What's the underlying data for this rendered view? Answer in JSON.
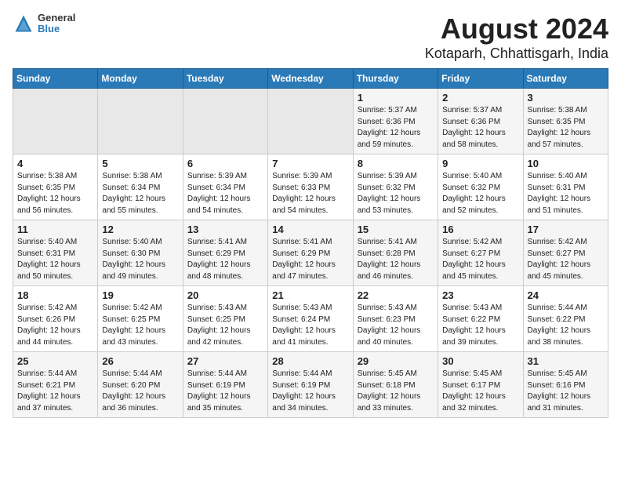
{
  "header": {
    "logo_line1": "General",
    "logo_line2": "Blue",
    "title": "August 2024",
    "subtitle": "Kotaparh, Chhattisgarh, India"
  },
  "weekdays": [
    "Sunday",
    "Monday",
    "Tuesday",
    "Wednesday",
    "Thursday",
    "Friday",
    "Saturday"
  ],
  "weeks": [
    [
      {
        "day": "",
        "info": ""
      },
      {
        "day": "",
        "info": ""
      },
      {
        "day": "",
        "info": ""
      },
      {
        "day": "",
        "info": ""
      },
      {
        "day": "1",
        "info": "Sunrise: 5:37 AM\nSunset: 6:36 PM\nDaylight: 12 hours\nand 59 minutes."
      },
      {
        "day": "2",
        "info": "Sunrise: 5:37 AM\nSunset: 6:36 PM\nDaylight: 12 hours\nand 58 minutes."
      },
      {
        "day": "3",
        "info": "Sunrise: 5:38 AM\nSunset: 6:35 PM\nDaylight: 12 hours\nand 57 minutes."
      }
    ],
    [
      {
        "day": "4",
        "info": "Sunrise: 5:38 AM\nSunset: 6:35 PM\nDaylight: 12 hours\nand 56 minutes."
      },
      {
        "day": "5",
        "info": "Sunrise: 5:38 AM\nSunset: 6:34 PM\nDaylight: 12 hours\nand 55 minutes."
      },
      {
        "day": "6",
        "info": "Sunrise: 5:39 AM\nSunset: 6:34 PM\nDaylight: 12 hours\nand 54 minutes."
      },
      {
        "day": "7",
        "info": "Sunrise: 5:39 AM\nSunset: 6:33 PM\nDaylight: 12 hours\nand 54 minutes."
      },
      {
        "day": "8",
        "info": "Sunrise: 5:39 AM\nSunset: 6:32 PM\nDaylight: 12 hours\nand 53 minutes."
      },
      {
        "day": "9",
        "info": "Sunrise: 5:40 AM\nSunset: 6:32 PM\nDaylight: 12 hours\nand 52 minutes."
      },
      {
        "day": "10",
        "info": "Sunrise: 5:40 AM\nSunset: 6:31 PM\nDaylight: 12 hours\nand 51 minutes."
      }
    ],
    [
      {
        "day": "11",
        "info": "Sunrise: 5:40 AM\nSunset: 6:31 PM\nDaylight: 12 hours\nand 50 minutes."
      },
      {
        "day": "12",
        "info": "Sunrise: 5:40 AM\nSunset: 6:30 PM\nDaylight: 12 hours\nand 49 minutes."
      },
      {
        "day": "13",
        "info": "Sunrise: 5:41 AM\nSunset: 6:29 PM\nDaylight: 12 hours\nand 48 minutes."
      },
      {
        "day": "14",
        "info": "Sunrise: 5:41 AM\nSunset: 6:29 PM\nDaylight: 12 hours\nand 47 minutes."
      },
      {
        "day": "15",
        "info": "Sunrise: 5:41 AM\nSunset: 6:28 PM\nDaylight: 12 hours\nand 46 minutes."
      },
      {
        "day": "16",
        "info": "Sunrise: 5:42 AM\nSunset: 6:27 PM\nDaylight: 12 hours\nand 45 minutes."
      },
      {
        "day": "17",
        "info": "Sunrise: 5:42 AM\nSunset: 6:27 PM\nDaylight: 12 hours\nand 45 minutes."
      }
    ],
    [
      {
        "day": "18",
        "info": "Sunrise: 5:42 AM\nSunset: 6:26 PM\nDaylight: 12 hours\nand 44 minutes."
      },
      {
        "day": "19",
        "info": "Sunrise: 5:42 AM\nSunset: 6:25 PM\nDaylight: 12 hours\nand 43 minutes."
      },
      {
        "day": "20",
        "info": "Sunrise: 5:43 AM\nSunset: 6:25 PM\nDaylight: 12 hours\nand 42 minutes."
      },
      {
        "day": "21",
        "info": "Sunrise: 5:43 AM\nSunset: 6:24 PM\nDaylight: 12 hours\nand 41 minutes."
      },
      {
        "day": "22",
        "info": "Sunrise: 5:43 AM\nSunset: 6:23 PM\nDaylight: 12 hours\nand 40 minutes."
      },
      {
        "day": "23",
        "info": "Sunrise: 5:43 AM\nSunset: 6:22 PM\nDaylight: 12 hours\nand 39 minutes."
      },
      {
        "day": "24",
        "info": "Sunrise: 5:44 AM\nSunset: 6:22 PM\nDaylight: 12 hours\nand 38 minutes."
      }
    ],
    [
      {
        "day": "25",
        "info": "Sunrise: 5:44 AM\nSunset: 6:21 PM\nDaylight: 12 hours\nand 37 minutes."
      },
      {
        "day": "26",
        "info": "Sunrise: 5:44 AM\nSunset: 6:20 PM\nDaylight: 12 hours\nand 36 minutes."
      },
      {
        "day": "27",
        "info": "Sunrise: 5:44 AM\nSunset: 6:19 PM\nDaylight: 12 hours\nand 35 minutes."
      },
      {
        "day": "28",
        "info": "Sunrise: 5:44 AM\nSunset: 6:19 PM\nDaylight: 12 hours\nand 34 minutes."
      },
      {
        "day": "29",
        "info": "Sunrise: 5:45 AM\nSunset: 6:18 PM\nDaylight: 12 hours\nand 33 minutes."
      },
      {
        "day": "30",
        "info": "Sunrise: 5:45 AM\nSunset: 6:17 PM\nDaylight: 12 hours\nand 32 minutes."
      },
      {
        "day": "31",
        "info": "Sunrise: 5:45 AM\nSunset: 6:16 PM\nDaylight: 12 hours\nand 31 minutes."
      }
    ]
  ]
}
